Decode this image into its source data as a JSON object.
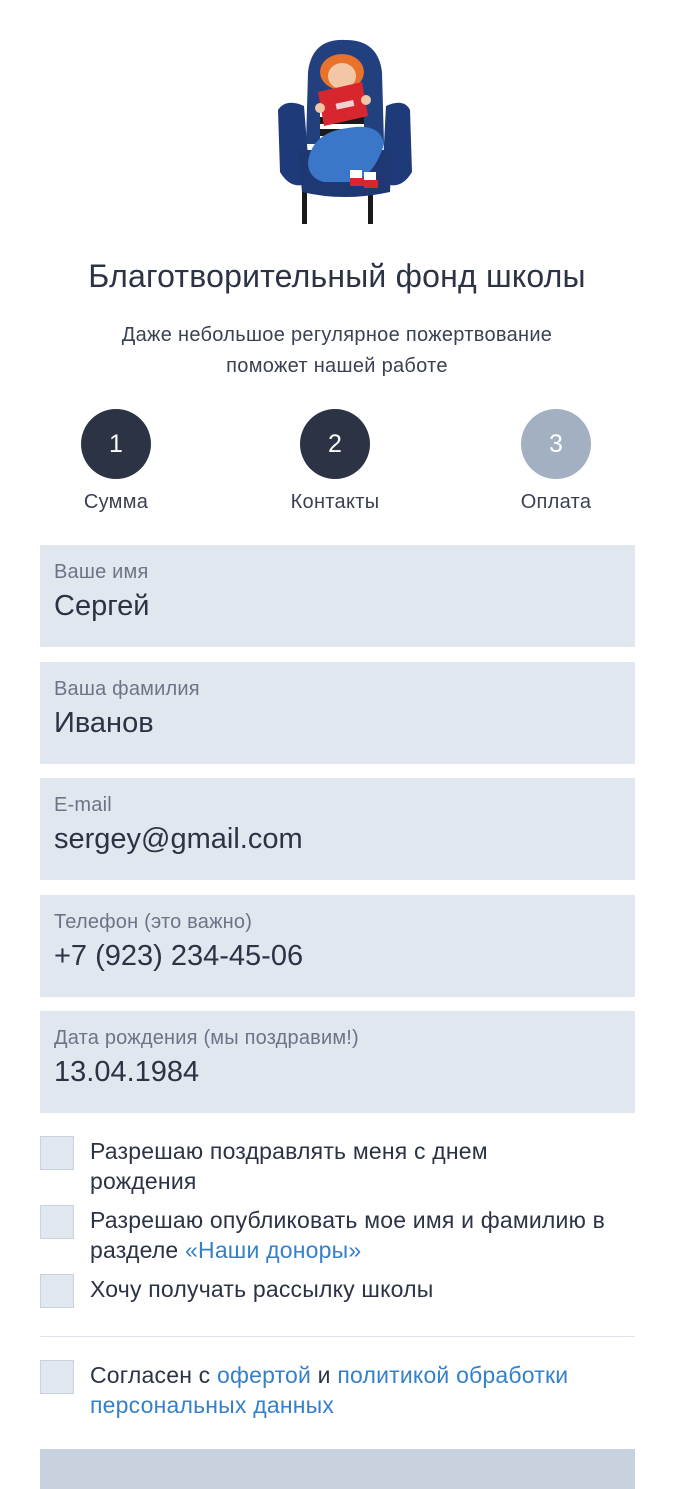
{
  "header": {
    "title": "Благотворительный фонд школы",
    "subtitle": "Даже небольшое регулярное пожертвование поможет нашей работе"
  },
  "steps": [
    {
      "number": "1",
      "label": "Сумма",
      "state": "done"
    },
    {
      "number": "2",
      "label": "Контакты",
      "state": "active"
    },
    {
      "number": "3",
      "label": "Оплата",
      "state": "pending"
    }
  ],
  "fields": {
    "first_name": {
      "label": "Ваше имя",
      "value": "Сергей"
    },
    "last_name": {
      "label": "Ваша фамилия",
      "value": "Иванов"
    },
    "email": {
      "label": "E-mail",
      "value": "sergey@gmail.com"
    },
    "phone": {
      "label": "Телефон (это важно)",
      "value": "+7 (923) 234-45-06"
    },
    "birthday": {
      "label": "Дата рождения (мы поздравим!)",
      "value": "13.04.1984"
    }
  },
  "checkboxes": {
    "birthday_greetings": {
      "text": "Разрешаю поздравлять меня с днем рождения",
      "checked": false
    },
    "publish_name": {
      "text_before": "Разрешаю опубликовать мое имя и фамилию в разделе ",
      "link": "«Наши доноры»",
      "checked": false
    },
    "newsletter": {
      "text": "Хочу получать рассылку школы",
      "checked": false
    },
    "agreement": {
      "text_before": "Согласен с ",
      "link_offer": "офертой",
      "middle": " и ",
      "link_policy": "политикой обработки персональных данных",
      "checked": false
    }
  },
  "colors": {
    "step_done": "#2b3345",
    "step_active": "#2b3345",
    "step_pending": "#a2b0c1",
    "field_bg": "#e1e7ef",
    "link": "#3580c8"
  },
  "icons": {
    "illustration": "girl-reading-in-armchair-illustration"
  }
}
